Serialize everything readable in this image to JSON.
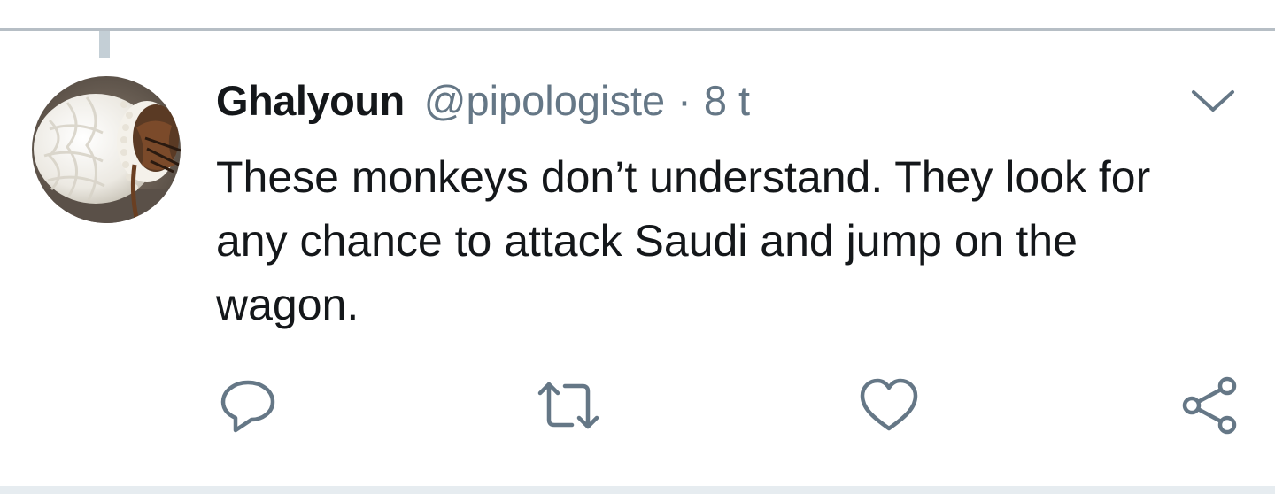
{
  "tweet": {
    "display_name": "Ghalyoun",
    "handle": "@pipologiste",
    "separator": "·",
    "time": "8 t",
    "text": "These monkeys don’t understand. They look for any chance to attack Saudi and jump on the wagon."
  },
  "actions": {
    "reply_icon": "reply-icon",
    "retweet_icon": "retweet-icon",
    "like_icon": "heart-icon",
    "share_icon": "share-icon",
    "menu_icon": "chevron-down-icon"
  },
  "colors": {
    "text_primary": "#14171a",
    "text_secondary": "#657786",
    "divider": "#b6bec5",
    "thread_line": "#c4cfd6"
  }
}
